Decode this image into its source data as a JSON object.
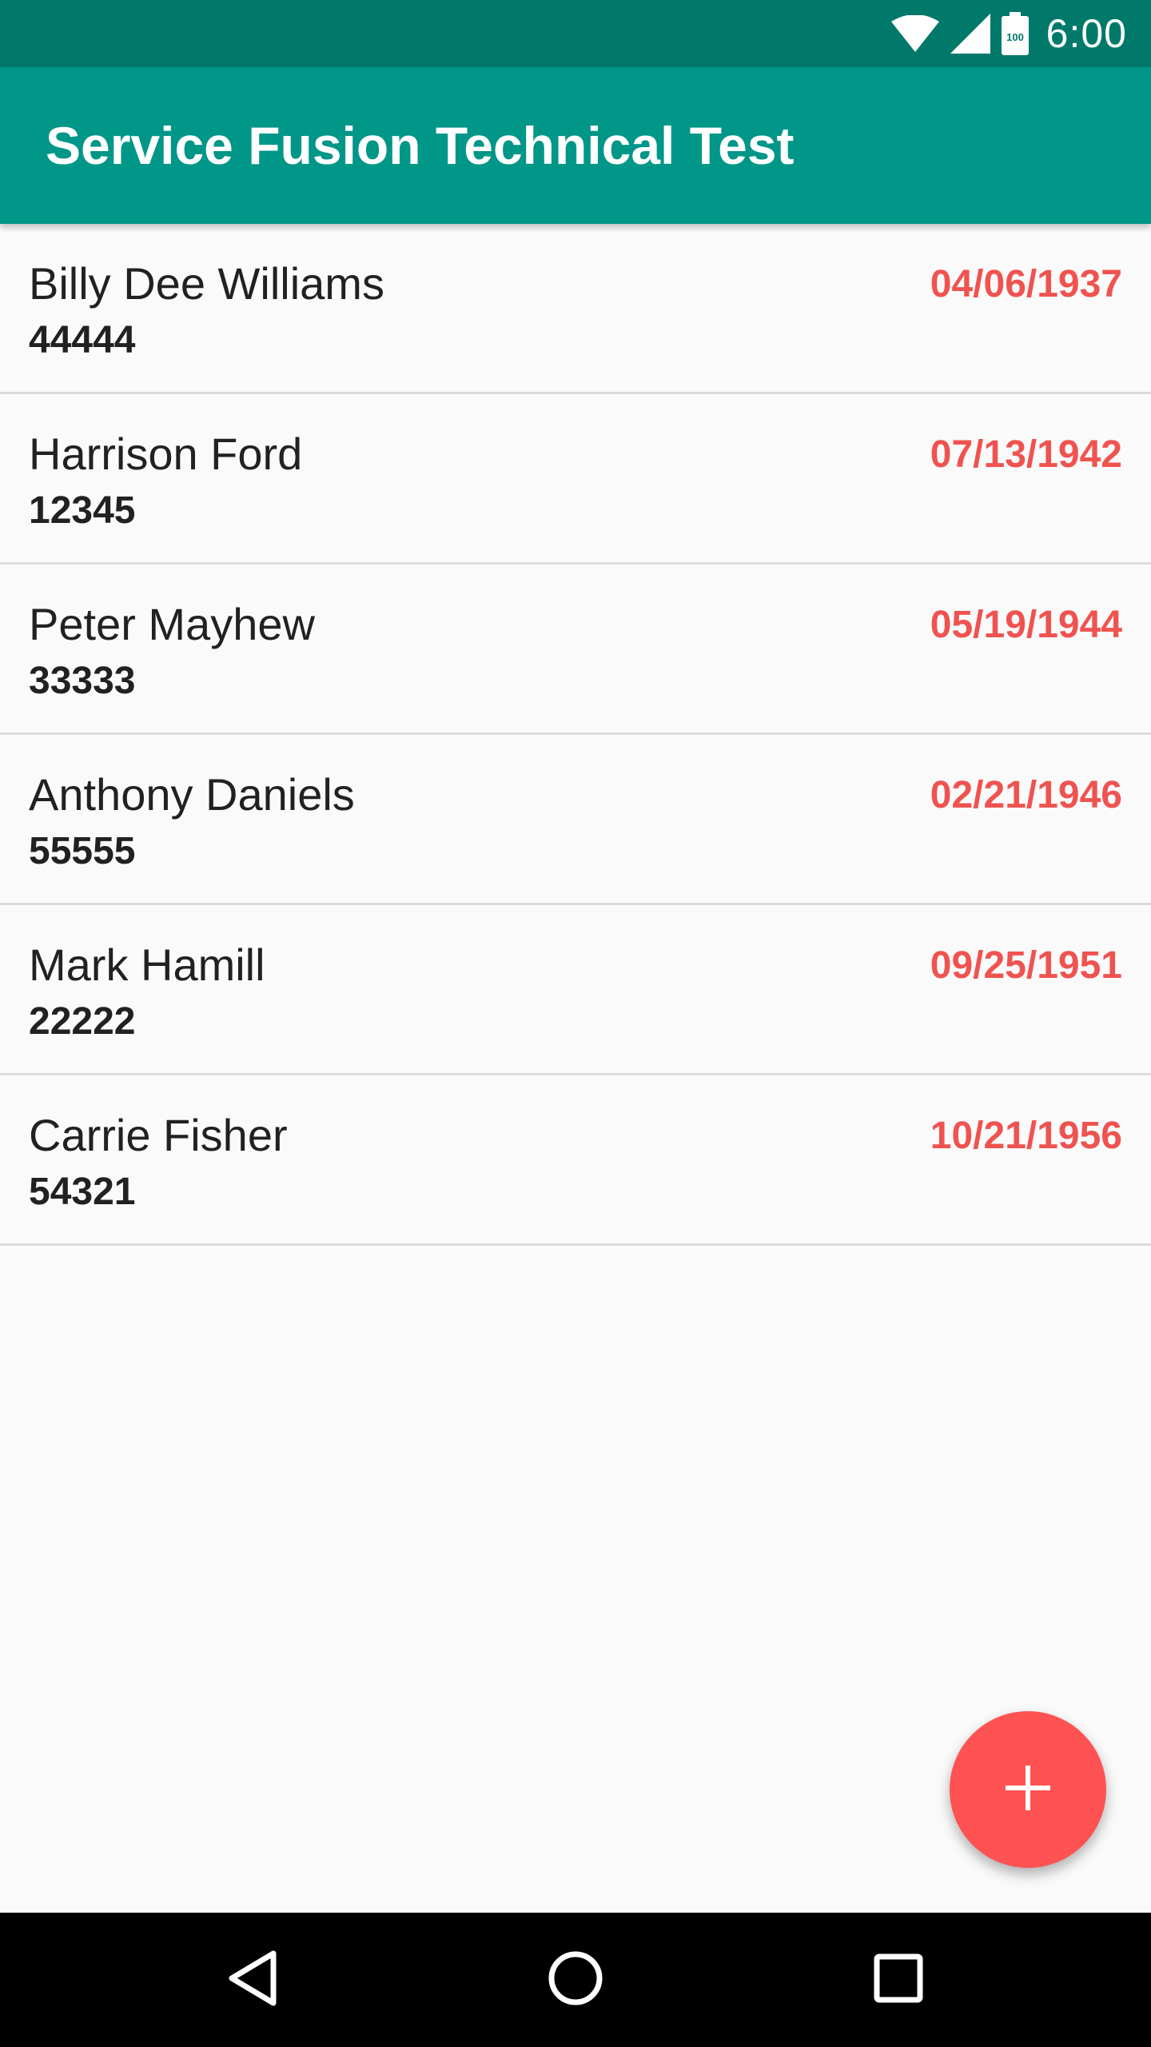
{
  "status_bar": {
    "time": "6:00",
    "battery_level": "100",
    "icons": [
      "wifi-icon",
      "signal-icon",
      "battery-icon"
    ]
  },
  "app_bar": {
    "title": "Service Fusion Technical Test"
  },
  "people": [
    {
      "name": "Billy Dee Williams",
      "number": "44444",
      "date": "04/06/1937"
    },
    {
      "name": "Harrison Ford",
      "number": "12345",
      "date": "07/13/1942"
    },
    {
      "name": "Peter Mayhew",
      "number": "33333",
      "date": "05/19/1944"
    },
    {
      "name": "Anthony Daniels",
      "number": "55555",
      "date": "02/21/1946"
    },
    {
      "name": "Mark Hamill",
      "number": "22222",
      "date": "09/25/1951"
    },
    {
      "name": "Carrie Fisher",
      "number": "54321",
      "date": "10/21/1956"
    }
  ],
  "fab": {
    "icon": "plus-icon"
  },
  "nav_bar": {
    "buttons": [
      "back-icon",
      "home-icon",
      "recents-icon"
    ]
  },
  "colors": {
    "status_bar": "#00796b",
    "app_bar": "#009688",
    "date_text": "#ef5350",
    "fab": "#ff5252",
    "background": "#fafafa"
  }
}
